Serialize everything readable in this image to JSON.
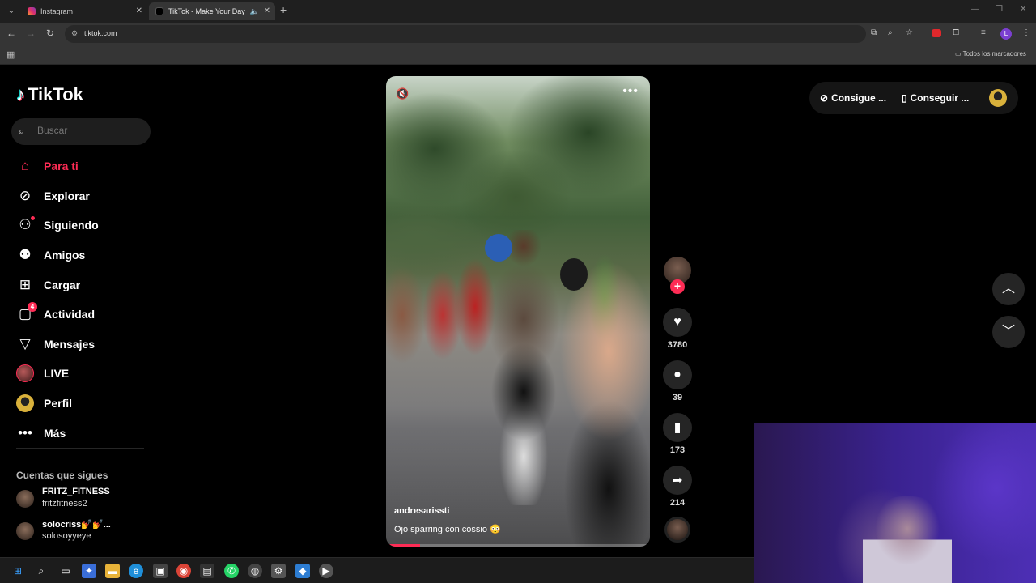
{
  "browser": {
    "tabs": [
      {
        "title": "Instagram"
      },
      {
        "title": "TikTok - Make Your Day"
      }
    ],
    "url": "tiktok.com",
    "bookmarks_folder": "Todos los marcadores",
    "profile_initial": "L"
  },
  "sidebar": {
    "logo": "TikTok",
    "search_placeholder": "Buscar",
    "nav": [
      {
        "label": "Para ti",
        "icon": "home-icon"
      },
      {
        "label": "Explorar",
        "icon": "compass-icon"
      },
      {
        "label": "Siguiendo",
        "icon": "following-icon"
      },
      {
        "label": "Amigos",
        "icon": "friends-icon"
      },
      {
        "label": "Cargar",
        "icon": "upload-icon"
      },
      {
        "label": "Actividad",
        "icon": "activity-icon",
        "badge": "4"
      },
      {
        "label": "Mensajes",
        "icon": "messages-icon"
      },
      {
        "label": "LIVE",
        "icon": "live-avatar"
      },
      {
        "label": "Perfil",
        "icon": "profile-avatar"
      },
      {
        "label": "Más",
        "icon": "more-icon"
      }
    ],
    "following_title": "Cuentas que sigues",
    "following": [
      {
        "name": "FRITZ_FITNESS",
        "handle": "fritzfitness2"
      },
      {
        "name": "solocriss💅💅...",
        "handle": "solosoyyeye"
      }
    ]
  },
  "video": {
    "author": "andresarissti",
    "caption": "Ojo sparring con cossio 😳",
    "progress": 0.13
  },
  "actions": {
    "likes": "3780",
    "comments": "39",
    "saves": "173",
    "shares": "214"
  },
  "topright": {
    "btn1": "Consigue ...",
    "btn2": "Conseguir ..."
  }
}
